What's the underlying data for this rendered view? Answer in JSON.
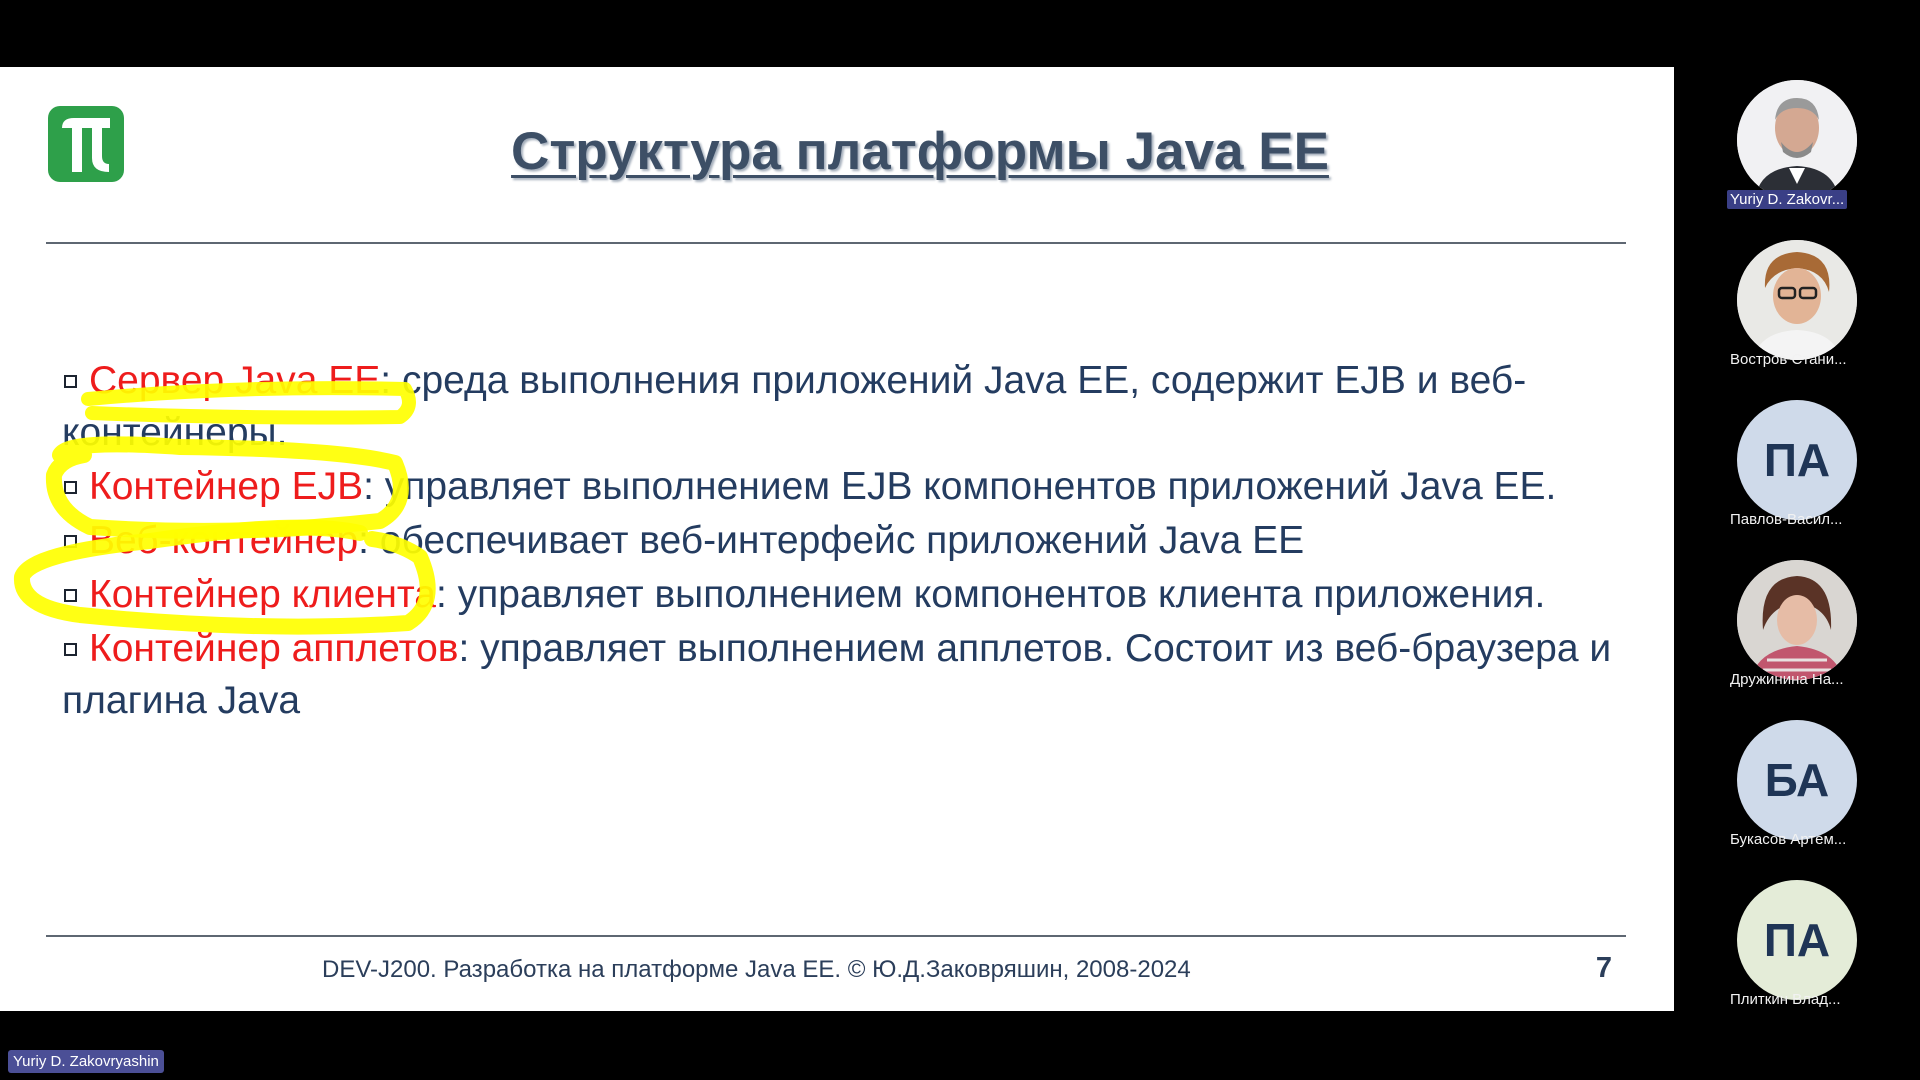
{
  "slide": {
    "title": "Структура платформы Java EE",
    "items": [
      {
        "term": "Сервер Java EE",
        "text": ": среда выполнения приложений Java EE, содержит EJB и веб-контейнеры."
      },
      {
        "term": "Контейнер EJB",
        "text": ": управляет выполнением EJB компонентов приложений Java EE."
      },
      {
        "term": "Веб-контейнер",
        "text": ": обеспечивает веб-интерфейс приложений Java EE"
      },
      {
        "term": "Контейнер клиента",
        "text": ": управляет выполнением компонентов клиента приложения."
      },
      {
        "term": "Контейнер апплетов",
        "text": ": управляет выполнением апплетов. Состоит из веб-браузера и плагина Java"
      }
    ],
    "footer": "DEV-J200. Разработка на платформе Java EE. © Ю.Д.Заковряшин, 2008-2024",
    "page_number": "7",
    "colors": {
      "title": "#3d4f66",
      "term": "#ee1c1c",
      "body": "#243c60",
      "highlight": "#ffff00",
      "logo": "#2ea04a"
    }
  },
  "participants": [
    {
      "name": "Yuriy D. Zakovr...",
      "avatar": "photo",
      "active": true
    },
    {
      "name": "Востров Стани...",
      "avatar": "photo",
      "active": false
    },
    {
      "name": "Павлов-Васил...",
      "initials": "ПА",
      "avatar_color": "#cfdaea",
      "active": false
    },
    {
      "name": "Дружинина На...",
      "avatar": "photo",
      "active": false
    },
    {
      "name": "Букасов Артем...",
      "initials": "БА",
      "avatar_color": "#cfdaea",
      "active": false
    },
    {
      "name": "Плиткин Влад...",
      "initials": "ПА",
      "avatar_color": "#e4ecd8",
      "active": false
    }
  ],
  "host": {
    "name": "Yuriy D. Zakovryashin"
  }
}
